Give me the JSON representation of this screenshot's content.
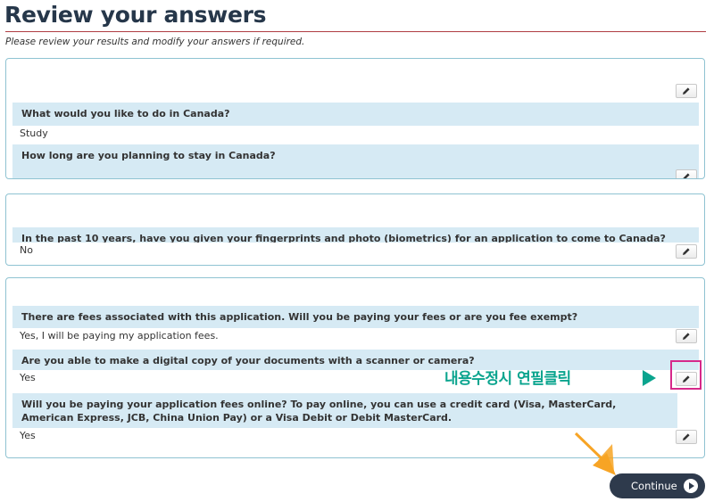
{
  "page": {
    "title": "Review your answers",
    "subtitle": "Please review your results and modify your answers if required."
  },
  "panels": [
    {
      "items": [
        {
          "question": "What would you like to do in Canada?",
          "answer": "Study"
        },
        {
          "question": "How long are you planning to stay in Canada?",
          "answer": ""
        }
      ]
    },
    {
      "items": [
        {
          "question": "In the past 10 years, have you given your fingerprints and photo (biometrics) for an application to come to Canada?",
          "answer": "No"
        }
      ]
    },
    {
      "items": [
        {
          "question": "There are fees associated with this application. Will you be paying your fees or are you fee exempt?",
          "answer": "Yes, I will be paying my application fees."
        },
        {
          "question": "Are you able to make a digital copy of your documents with a scanner or camera?",
          "answer": "Yes"
        },
        {
          "question": "Will you be paying your application fees online?  To pay online, you can use a credit card (Visa, MasterCard, American Express, JCB, China Union Pay) or a Visa Debit or Debit MasterCard.",
          "answer": "Yes"
        }
      ]
    }
  ],
  "annotation": {
    "note": "내용수정시 연필클릭",
    "highlight_color": "#d6288a",
    "note_color": "#0aa48e",
    "pointer_color": "#f7a425"
  },
  "continue_label": "Continue",
  "icons": {
    "edit": "pencil-icon",
    "continue": "play-circle-icon"
  }
}
